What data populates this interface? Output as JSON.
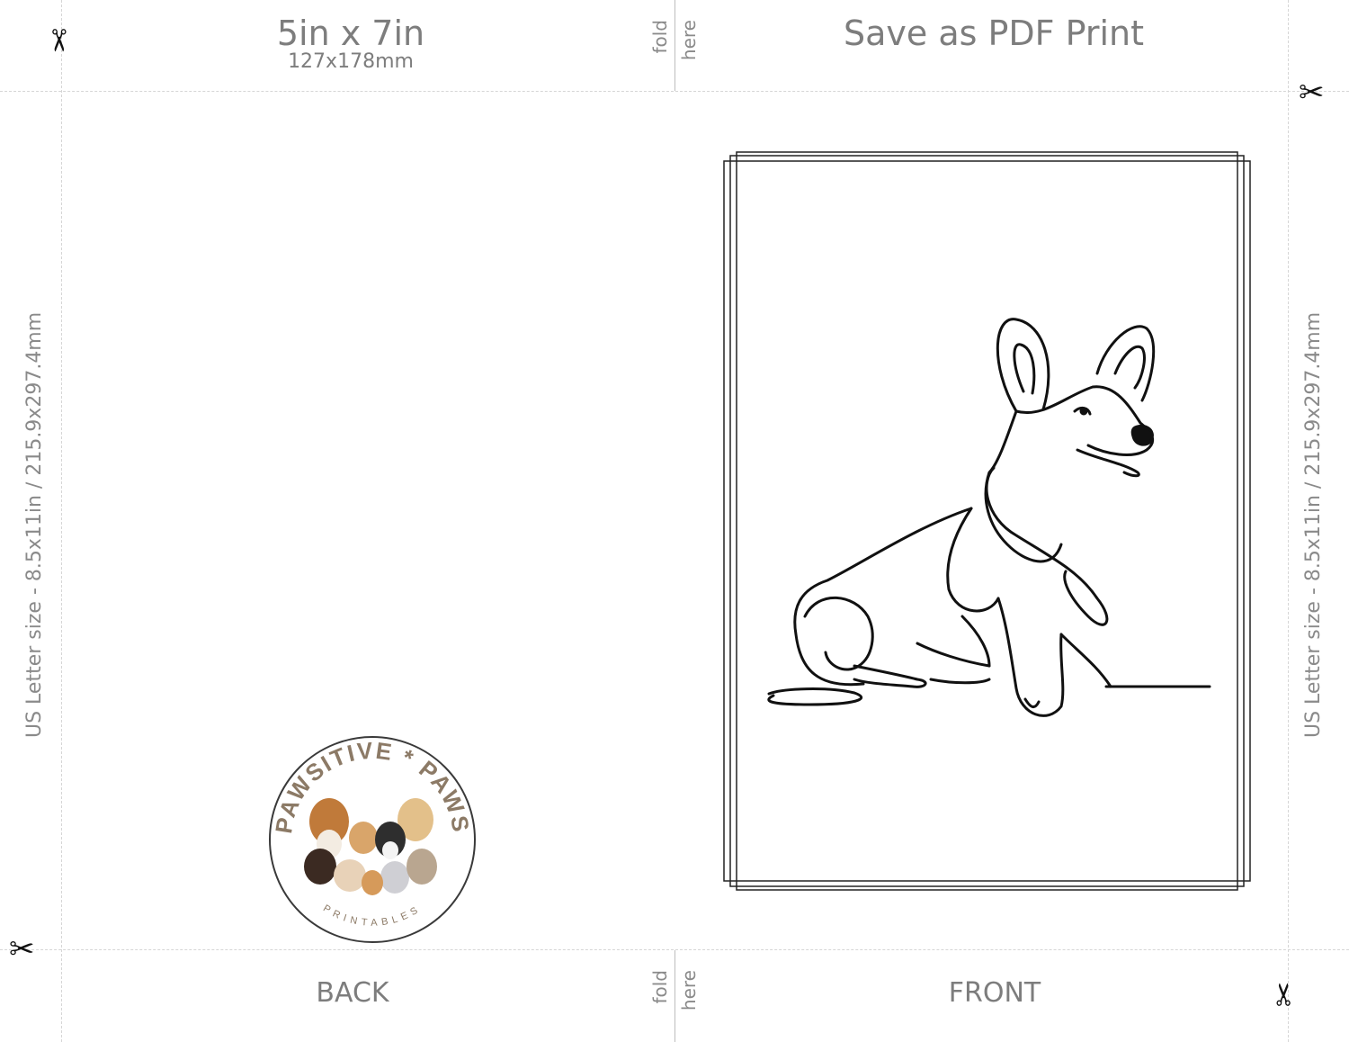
{
  "header": {
    "card_size": "5in x 7in",
    "card_size_mm": "127x178mm",
    "save_instruction": "Save as PDF Print"
  },
  "fold": {
    "word1": "fold",
    "word2": "here"
  },
  "sidebar": {
    "paper_size": "US Letter size - 8.5x11in / 215.9x297.4mm"
  },
  "labels": {
    "back": "BACK",
    "front": "FRONT"
  },
  "logo": {
    "text_top": "PAWSITIVE * PAWS",
    "text_bottom": "PRINTABLES"
  },
  "icons": {
    "cut_mark": "scissors-icon",
    "artwork": "corgi-line-drawing"
  },
  "colors": {
    "text_gray": "#7d7d7d",
    "logo_brown": "#8c7a66",
    "guide": "#d6d6d6"
  }
}
